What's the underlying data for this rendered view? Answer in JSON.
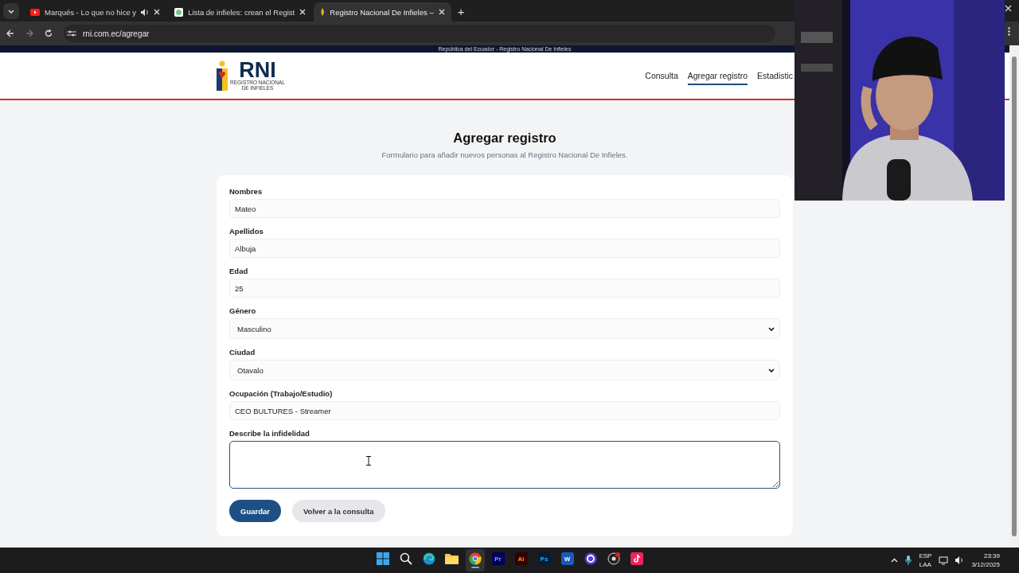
{
  "browser": {
    "tabs": [
      {
        "title": "Marqués - Lo que no hice y",
        "kind": "video",
        "audio": true,
        "selected": false
      },
      {
        "title": "Lista de infieles: crean el Regist",
        "kind": "news",
        "audio": false,
        "selected": false
      },
      {
        "title": "Registro Nacional De Infieles –",
        "kind": "site",
        "audio": false,
        "selected": true
      }
    ],
    "new_tab": "+",
    "url": "rni.com.ec/agregar"
  },
  "page": {
    "banner": "República del Ecuador - Registro Nacional De Infieles",
    "logo": {
      "mark": "RNI",
      "lines": [
        "REGISTRO NACIONAL",
        "DE INFIELES"
      ]
    },
    "nav": [
      {
        "label": "Consulta",
        "selected": false
      },
      {
        "label": "Agregar registro",
        "selected": true
      },
      {
        "label": "Estadistic",
        "selected": false
      }
    ],
    "title": "Agregar registro",
    "subtitle": "Formulario para añadir nuevos personas al Registro Nacional De Infieles.",
    "fields": [
      {
        "kind": "text",
        "label": "Nombres",
        "value": "Mateo"
      },
      {
        "kind": "text",
        "label": "Apellidos",
        "value": "Albuja"
      },
      {
        "kind": "text",
        "label": "Edad",
        "value": "25"
      },
      {
        "kind": "select",
        "label": "Género",
        "value": "Masculino"
      },
      {
        "kind": "select",
        "label": "Ciudad",
        "value": "Otavalo"
      },
      {
        "kind": "text",
        "label": "Ocupación (Trabajo/Estudio)",
        "value": "CEO BULTURES - Streamer"
      },
      {
        "kind": "textarea",
        "label": "Describe la infidelidad",
        "focused": true
      }
    ],
    "buttons": [
      {
        "label": "Guardar",
        "kind": "primary"
      },
      {
        "label": "Volver a la consulta",
        "kind": "secondary"
      }
    ]
  },
  "taskbar": {
    "apps": [
      {
        "kind": "start",
        "active": false
      },
      {
        "kind": "search",
        "active": false
      },
      {
        "kind": "edge",
        "active": false
      },
      {
        "kind": "folder",
        "active": false
      },
      {
        "kind": "chrome",
        "active": true
      },
      {
        "kind": "premiere",
        "label": "Pr",
        "active": false
      },
      {
        "kind": "illustrator",
        "label": "Ai",
        "active": false
      },
      {
        "kind": "photoshop",
        "label": "Ps",
        "active": false
      },
      {
        "kind": "word",
        "label": "W",
        "active": false
      },
      {
        "kind": "ring",
        "active": false
      },
      {
        "kind": "obs",
        "active": false
      },
      {
        "kind": "tiktok",
        "active": false
      }
    ],
    "language": [
      "ESP",
      "LAA"
    ],
    "time": "23:39",
    "date": "3/12/2025"
  }
}
